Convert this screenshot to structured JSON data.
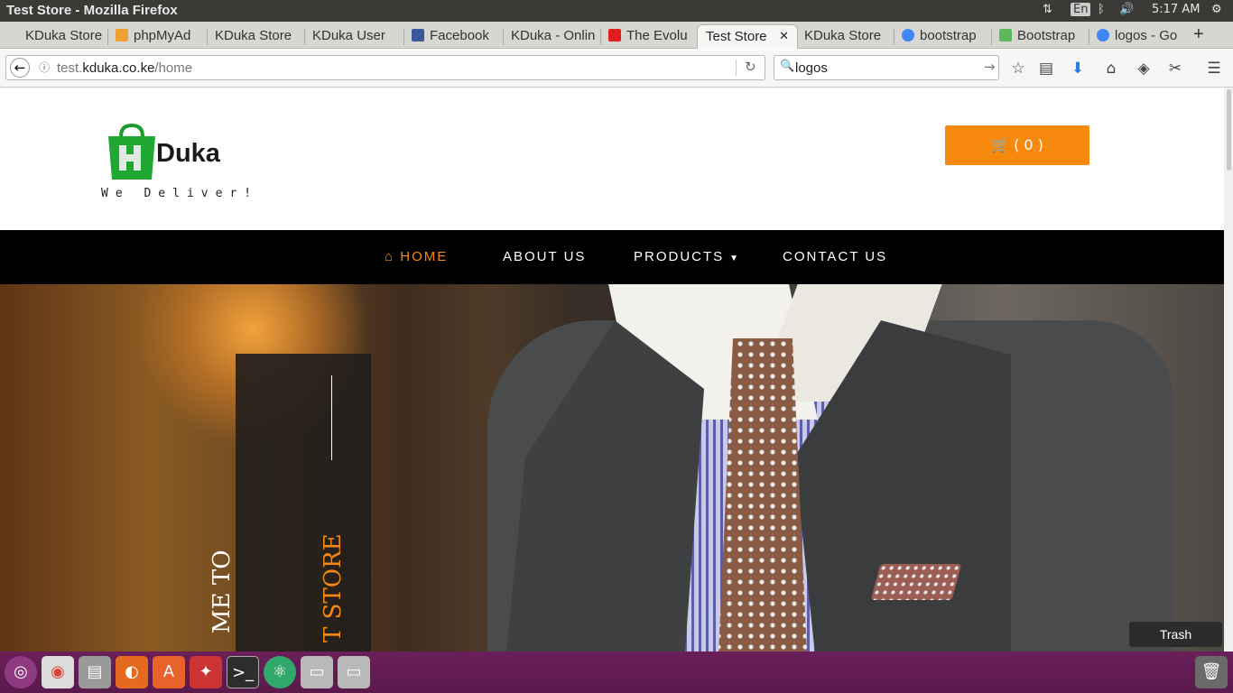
{
  "os": {
    "window_title": "Test Store - Mozilla Firefox",
    "lang": "En",
    "clock": "5:17 AM"
  },
  "browser": {
    "tabs": [
      {
        "label": "KDuka Store",
        "icon_color": "#888"
      },
      {
        "label": "phpMyAd",
        "icon_color": "#f0a030"
      },
      {
        "label": "KDuka Store",
        "icon_color": "#888"
      },
      {
        "label": "KDuka User",
        "icon_color": "#888"
      },
      {
        "label": "Facebook",
        "icon_color": "#3b5998"
      },
      {
        "label": "KDuka - Onlin",
        "icon_color": "#888"
      },
      {
        "label": "The Evolu",
        "icon_color": "#e02020"
      },
      {
        "label": "Test Store",
        "icon_color": "#888"
      },
      {
        "label": "KDuka Store",
        "icon_color": "#888"
      },
      {
        "label": "bootstrap",
        "icon_color": "#4285f4"
      },
      {
        "label": "Bootstrap",
        "icon_color": "#5cb85c"
      },
      {
        "label": "logos - Go",
        "icon_color": "#4285f4"
      }
    ],
    "url": {
      "prefix": "test.",
      "domain": "kduka.co.ke",
      "path": "/home"
    },
    "search_value": "logos"
  },
  "site": {
    "logo_text": "Duka",
    "tagline": "We Deliver!",
    "cart_label": "( 0 )",
    "nav": [
      {
        "label": "HOME",
        "active": true
      },
      {
        "label": "ABOUT US",
        "active": false
      },
      {
        "label": "PRODUCTS",
        "active": false
      },
      {
        "label": "CONTACT US",
        "active": false
      }
    ],
    "hero": {
      "line1": "ME TO",
      "line2": "T STORE"
    }
  },
  "desktop": {
    "trash_tooltip": "Trash"
  },
  "colors": {
    "accent": "#f7890f",
    "nav_bg": "#000000",
    "launcher": "#5a1a4c"
  }
}
